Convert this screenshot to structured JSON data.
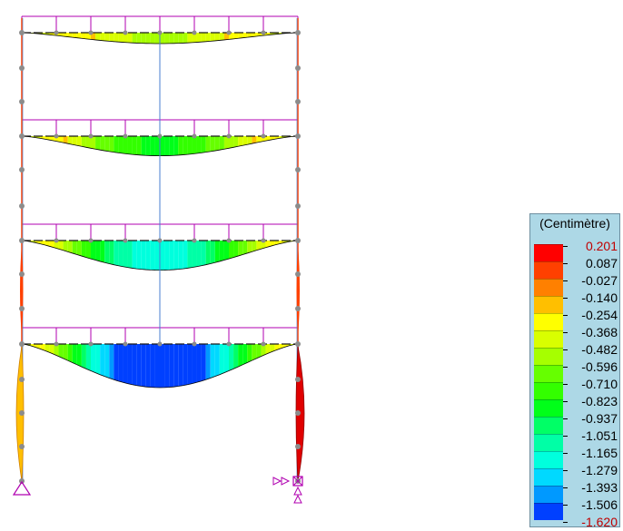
{
  "legend": {
    "title": "(Centimètre)",
    "labels": [
      "0.201",
      "0.087",
      "-0.027",
      "-0.140",
      "-0.254",
      "-0.368",
      "-0.482",
      "-0.596",
      "-0.710",
      "-0.823",
      "-0.937",
      "-1.051",
      "-1.165",
      "-1.279",
      "-1.393",
      "-1.506",
      "-1.620"
    ],
    "colors": [
      "#ff0000",
      "#ff4000",
      "#ff8000",
      "#ffbf00",
      "#ffff00",
      "#d9ff00",
      "#a6ff00",
      "#66ff00",
      "#33ff00",
      "#00ff19",
      "#00ff66",
      "#00ffa6",
      "#00ffdd",
      "#00d9ff",
      "#0099ff",
      "#0040ff"
    ]
  },
  "structure": {
    "beam_peak_deflection": [
      0.25,
      0.45,
      0.68,
      1.0
    ],
    "column_color": "#ff4000",
    "load_color": "#b000b0",
    "node_color": "#8c8c8c",
    "frame_line_color": "#4a7fd0"
  }
}
